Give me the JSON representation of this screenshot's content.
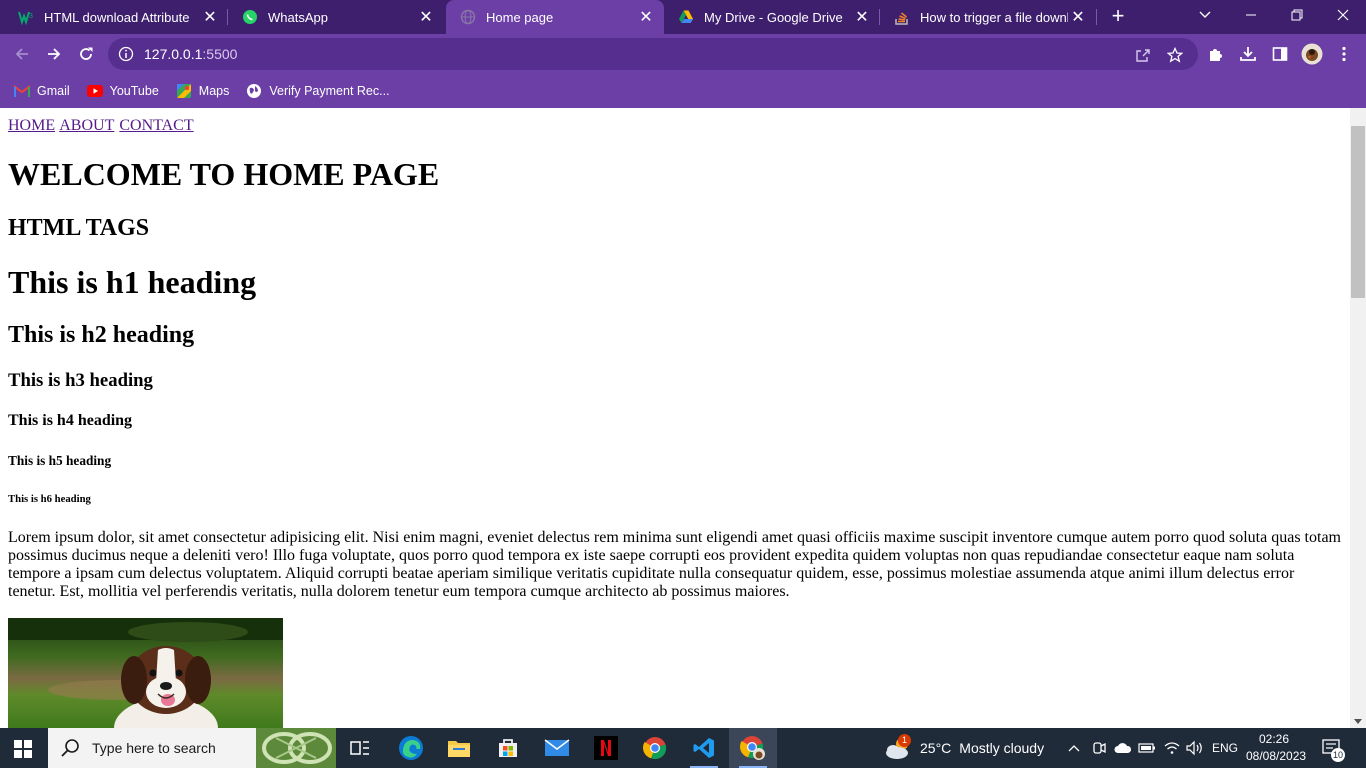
{
  "browser": {
    "tabs": [
      {
        "title": "HTML download Attribute",
        "icon": "w3schools-icon",
        "active": false
      },
      {
        "title": "WhatsApp",
        "icon": "whatsapp-icon",
        "active": false
      },
      {
        "title": "Home page",
        "icon": "globe-icon",
        "active": true
      },
      {
        "title": "My Drive - Google Drive",
        "icon": "google-drive-icon",
        "active": false
      },
      {
        "title": "How to trigger a file downlo",
        "icon": "stackoverflow-icon",
        "active": false
      }
    ],
    "address_host": "127.0.0.1",
    "address_port": ":5500",
    "bookmarks": [
      {
        "label": "Gmail",
        "icon": "gmail-icon"
      },
      {
        "label": "YouTube",
        "icon": "youtube-icon"
      },
      {
        "label": "Maps",
        "icon": "maps-icon"
      },
      {
        "label": "Verify Payment Rec...",
        "icon": "globe-icon"
      }
    ],
    "theme_colors": {
      "tabstrip": "#3d1f6e",
      "toolbar": "#6b3fa6"
    }
  },
  "page": {
    "nav": [
      "HOME",
      "ABOUT",
      "CONTACT"
    ],
    "welcome": "WELCOME TO HOME PAGE",
    "section_title": "HTML TAGS",
    "headings": [
      "This is h1 heading",
      "This is h2 heading",
      "This is h3 heading",
      "This is h4 heading",
      "This is h5 heading",
      "This is h6 heading"
    ],
    "lorem": "Lorem ipsum dolor, sit amet consectetur adipisicing elit. Nisi enim magni, eveniet delectus rem minima sunt eligendi amet quasi officiis maxime suscipit inventore cumque autem porro quod soluta quas totam possimus ducimus neque a deleniti vero! Illo fuga voluptate, quos porro quod tempora ex iste saepe corrupti eos provident expedita quidem voluptas non quas repudiandae consectetur eaque nam soluta tempore a ipsam cum delectus voluptatem. Aliquid corrupti beatae aperiam similique veritatis cupiditate nulla consequatur quidem, esse, possimus molestiae assumenda atque animi illum delectus error tenetur. Est, mollitia vel perferendis veritatis, nulla dolorem tenetur eum tempora cumque architecto ab possimus maiores.",
    "image": "puppy-photo"
  },
  "taskbar": {
    "search_placeholder": "Type here to search",
    "weather_temp": "25°C",
    "weather_desc": "Mostly cloudy",
    "weather_badge": "1",
    "language": "ENG",
    "time": "02:26",
    "date": "08/08/2023",
    "notification_count": "10"
  }
}
